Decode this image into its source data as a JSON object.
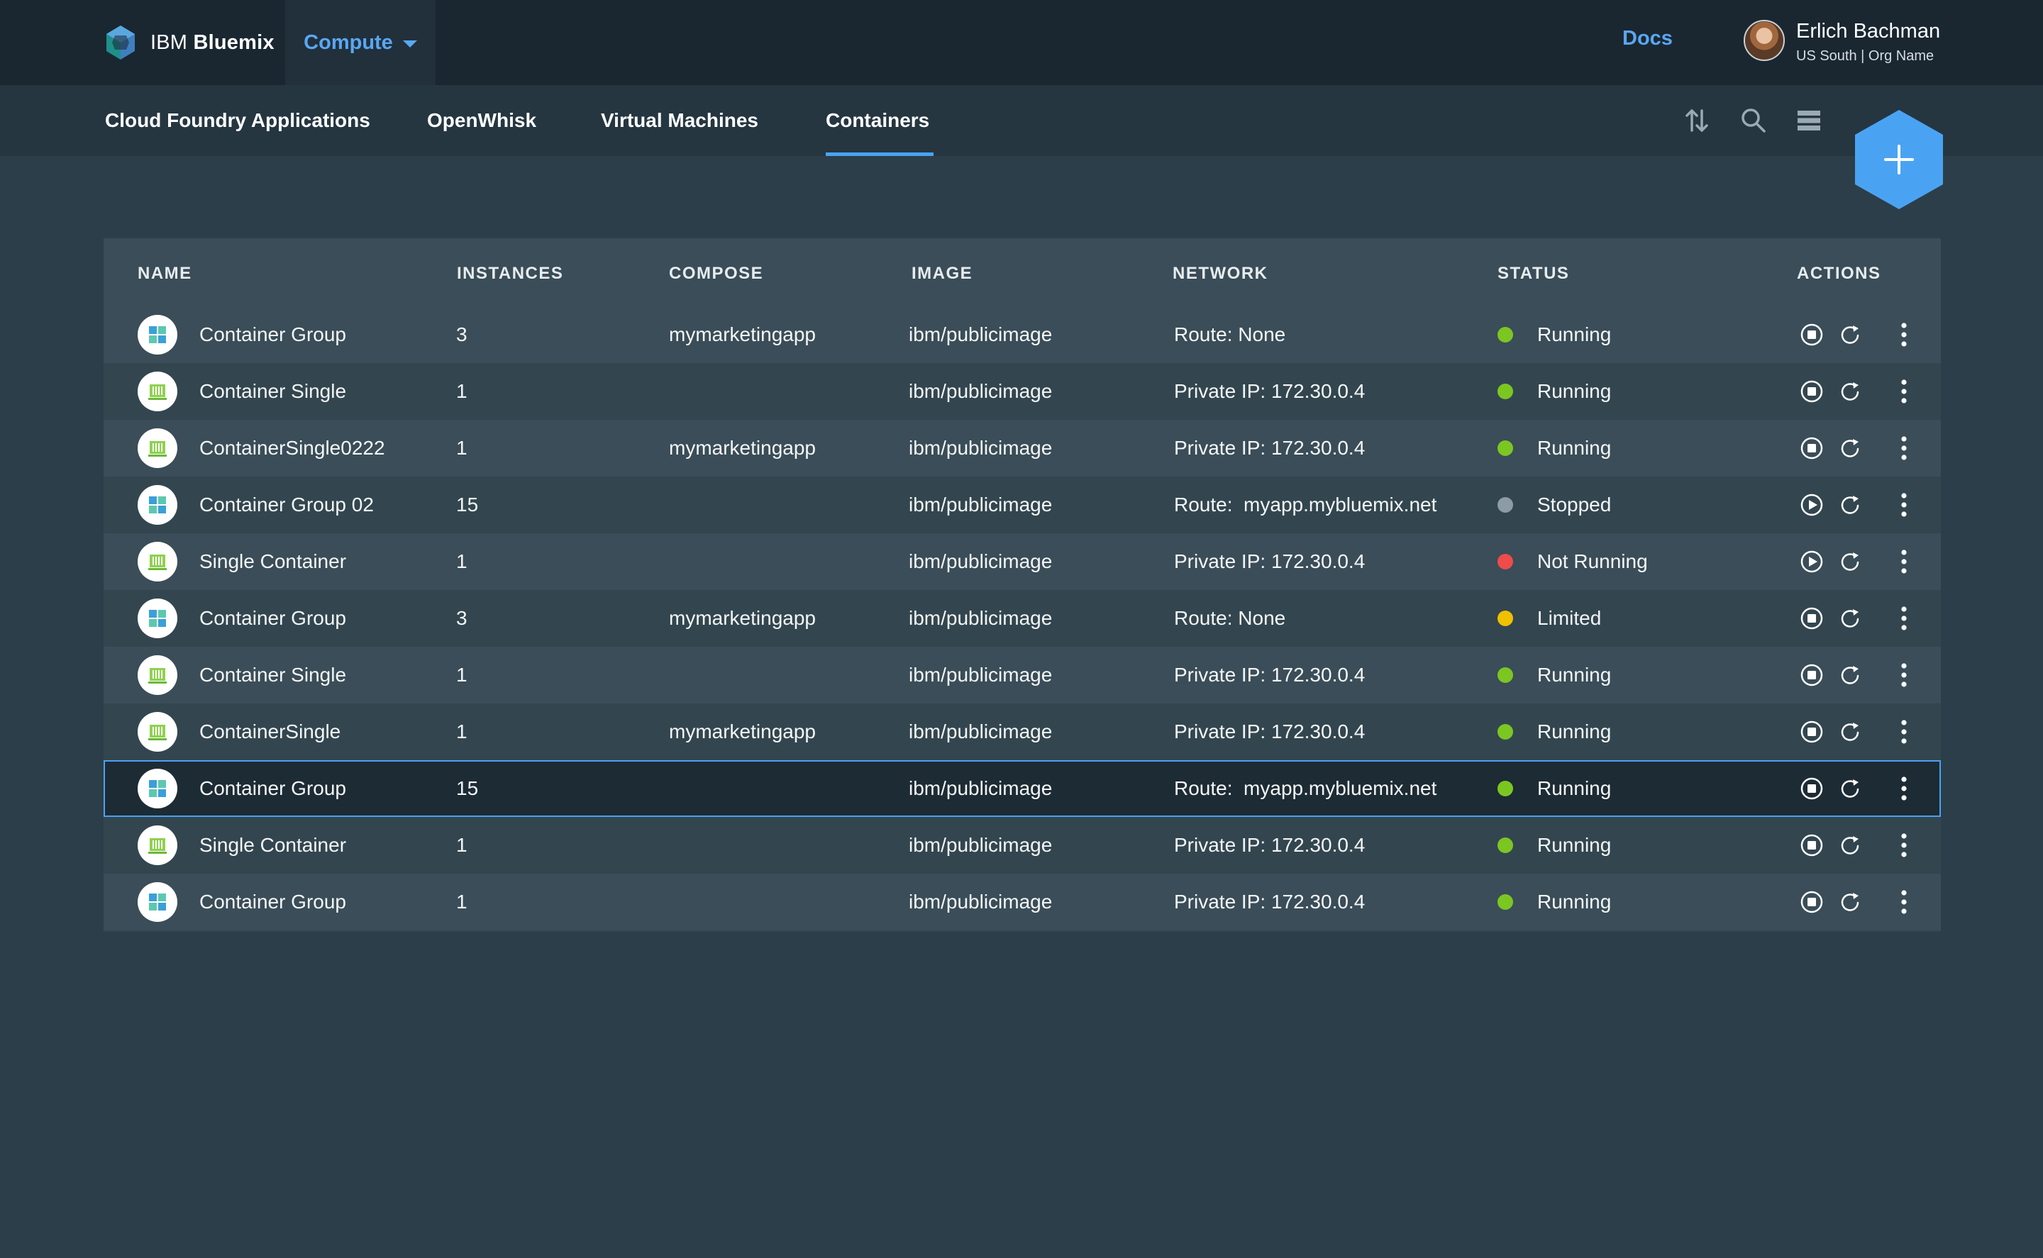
{
  "header": {
    "brand_prefix": "IBM",
    "brand_name": "Bluemix",
    "compute_label": "Compute",
    "docs_label": "Docs",
    "user_name": "Erlich Bachman",
    "user_org": "US South | Org Name"
  },
  "tabs": [
    {
      "label": "Cloud Foundry Applications"
    },
    {
      "label": "OpenWhisk"
    },
    {
      "label": "Virtual Machines"
    },
    {
      "label": "Containers",
      "active": true
    }
  ],
  "toolbar": {
    "icons": [
      "sort-icon",
      "search-icon",
      "list-view-icon"
    ],
    "add_button_icon": "plus-icon"
  },
  "table": {
    "columns": [
      "NAME",
      "INSTANCES",
      "COMPOSE",
      "IMAGE",
      "NETWORK",
      "STATUS",
      "ACTIONS"
    ],
    "rows": [
      {
        "type": "group",
        "name": "Container Group",
        "instances": "3",
        "compose": "mymarketingapp",
        "image": "ibm/publicimage",
        "network": "Route: None",
        "status": "Running",
        "status_color": "#7cc622",
        "action": "stop"
      },
      {
        "type": "single",
        "name": "Container Single",
        "instances": "1",
        "compose": "",
        "image": "ibm/publicimage",
        "network": "Private IP: 172.30.0.4",
        "status": "Running",
        "status_color": "#7cc622",
        "action": "stop"
      },
      {
        "type": "single",
        "name": "ContainerSingle0222",
        "instances": "1",
        "compose": "mymarketingapp",
        "image": "ibm/publicimage",
        "network": "Private IP: 172.30.0.4",
        "status": "Running",
        "status_color": "#7cc622",
        "action": "stop"
      },
      {
        "type": "group",
        "name": "Container Group 02",
        "instances": "15",
        "compose": "",
        "image": "ibm/publicimage",
        "network": "Route:  myapp.mybluemix.net",
        "status": "Stopped",
        "status_color": "#8c9ba5",
        "action": "play"
      },
      {
        "type": "single",
        "name": "Single Container",
        "instances": "1",
        "compose": "",
        "image": "ibm/publicimage",
        "network": "Private IP: 172.30.0.4",
        "status": "Not Running",
        "status_color": "#ef4b4b",
        "action": "play"
      },
      {
        "type": "group",
        "name": "Container Group",
        "instances": "3",
        "compose": "mymarketingapp",
        "image": "ibm/publicimage",
        "network": "Route: None",
        "status": "Limited",
        "status_color": "#efc100",
        "action": "stop"
      },
      {
        "type": "single",
        "name": "Container Single",
        "instances": "1",
        "compose": "",
        "image": "ibm/publicimage",
        "network": "Private IP: 172.30.0.4",
        "status": "Running",
        "status_color": "#7cc622",
        "action": "stop"
      },
      {
        "type": "single",
        "name": "ContainerSingle",
        "instances": "1",
        "compose": "mymarketingapp",
        "image": "ibm/publicimage",
        "network": "Private IP: 172.30.0.4",
        "status": "Running",
        "status_color": "#7cc622",
        "action": "stop"
      },
      {
        "type": "group",
        "name": "Container Group",
        "instances": "15",
        "compose": "",
        "image": "ibm/publicimage",
        "network": "Route:  myapp.mybluemix.net",
        "status": "Running",
        "status_color": "#7cc622",
        "action": "stop",
        "selected": true
      },
      {
        "type": "single",
        "name": "Single Container",
        "instances": "1",
        "compose": "",
        "image": "ibm/publicimage",
        "network": "Private IP: 172.30.0.4",
        "status": "Running",
        "status_color": "#7cc622",
        "action": "stop"
      },
      {
        "type": "group",
        "name": "Container Group",
        "instances": "1",
        "compose": "",
        "image": "ibm/publicimage",
        "network": "Private IP: 172.30.0.4",
        "status": "Running",
        "status_color": "#7cc622",
        "action": "stop"
      }
    ]
  }
}
